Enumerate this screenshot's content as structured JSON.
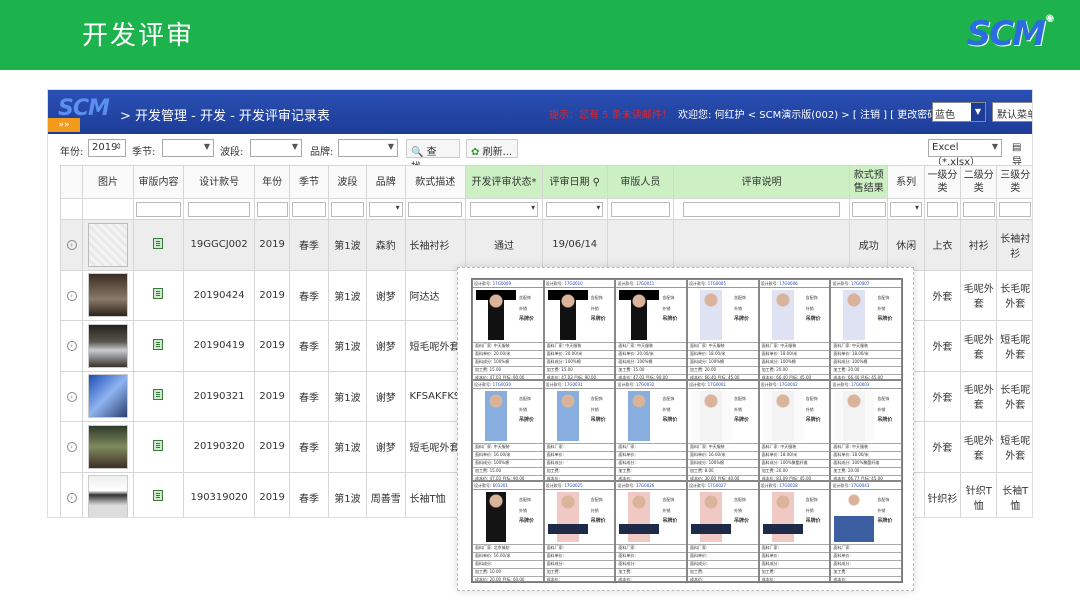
{
  "slide": {
    "title": "开发评审",
    "logo": "SCM",
    "logo_reg": "®"
  },
  "app": {
    "logo": "SCM",
    "tag": "»»",
    "breadcrumb": "> 开发管理 - 开发 - 开发评审记录表",
    "tip": "提示：您有 5 条未读邮件！",
    "welcome": "欢迎您: 何红护 < SCM演示版(002) > [ 注销 ] [ 更改密码 ]",
    "theme_select": "蓝色",
    "default_button": "默认菜单"
  },
  "filters": {
    "year_label": "年份:",
    "year_value": "2019",
    "season_label": "季节:",
    "wave_label": "波段:",
    "brand_label": "品牌:",
    "search_label": "查找...",
    "refresh_label": "刷新...",
    "export_value": "Excel（*.xlsx）",
    "export_label": "导"
  },
  "table": {
    "headers": [
      "图片",
      "审版内容",
      "设计款号",
      "年份",
      "季节",
      "波段",
      "品牌",
      "款式描述",
      "开发评审状态*",
      "评审日期",
      "审版人员",
      "评审说明",
      "款式预售结果",
      "系列",
      "一级分类",
      "二级分类",
      "三级分类"
    ],
    "rows": [
      {
        "no": "19GGCJ002",
        "year": "2019",
        "season": "春季",
        "wave": "第1波",
        "brand": "森豹",
        "desc": "长袖衬衫",
        "status": "通过",
        "date": "19/06/14",
        "result": "成功",
        "series": "休闲",
        "c1": "上衣",
        "c2": "衬衫",
        "c3": "长袖衬衫"
      },
      {
        "no": "20190424",
        "year": "2019",
        "season": "春季",
        "wave": "第1波",
        "brand": "谢梦",
        "desc": "阿达达",
        "status": "",
        "date": "",
        "result": "",
        "series": "",
        "c1": "外套",
        "c2": "毛呢外套",
        "c3": "长毛呢外套"
      },
      {
        "no": "20190419",
        "year": "2019",
        "season": "春季",
        "wave": "第1波",
        "brand": "谢梦",
        "desc": "短毛呢外套",
        "status": "",
        "date": "",
        "result": "",
        "series": "",
        "c1": "外套",
        "c2": "毛呢外套",
        "c3": "短毛呢外套"
      },
      {
        "no": "20190321",
        "year": "2019",
        "season": "春季",
        "wave": "第1波",
        "brand": "谢梦",
        "desc": "KFSAKFKSAF",
        "status": "",
        "date": "",
        "result": "",
        "series": "",
        "c1": "外套",
        "c2": "毛呢外套",
        "c3": "长毛呢外套"
      },
      {
        "no": "20190320",
        "year": "2019",
        "season": "春季",
        "wave": "第1波",
        "brand": "谢梦",
        "desc": "短毛呢外套",
        "status": "",
        "date": "",
        "result": "",
        "series": "",
        "c1": "外套",
        "c2": "毛呢外套",
        "c3": "短毛呢外套"
      },
      {
        "no": "190319020",
        "year": "2019",
        "season": "春季",
        "wave": "第1波",
        "brand": "周善雪",
        "desc": "长袖T恤",
        "status": "",
        "date": "",
        "result": "",
        "series": "",
        "c1": "针织衫",
        "c2": "针织T恤",
        "c3": "长袖T恤"
      }
    ]
  },
  "sheet": {
    "labels": {
      "design_no": "设计款号:",
      "fabric": "面料厂家:",
      "fabric_price": "面料单价:",
      "fabric_comp": "面料成分:",
      "process": "加工费:",
      "cost": "成本价:",
      "contains": "含配饰",
      "outer": "外销",
      "tag_price": "吊牌价"
    },
    "cards": [
      {
        "no": "17G0009",
        "fabric": "中天服装",
        "price": "20.00/米",
        "comp": "100%棉",
        "process": "15.00",
        "cost": "47.03  目标: 90.00",
        "pic": "black"
      },
      {
        "no": "17G0010",
        "fabric": "中天服装",
        "price": "20.00/米",
        "comp": "100%棉",
        "process": "15.00",
        "cost": "47.03  目标: 90.00",
        "pic": "black"
      },
      {
        "no": "17G0011",
        "fabric": "中天服装",
        "price": "20.00/米",
        "comp": "100%棉",
        "process": "15.00",
        "cost": "47.03  目标: 90.00",
        "pic": "black"
      },
      {
        "no": "17G0005",
        "fabric": "中天服装",
        "price": "18.00/米",
        "comp": "100%棉",
        "process": "20.00",
        "cost": "66.40  目标: 45.00",
        "pic": "white"
      },
      {
        "no": "17G0006",
        "fabric": "中天服装",
        "price": "18.00/米",
        "comp": "100%棉",
        "process": "20.00",
        "cost": "66.40  目标: 45.00",
        "pic": "white"
      },
      {
        "no": "17G0007",
        "fabric": "中天服装",
        "price": "18.00/米",
        "comp": "100%棉",
        "process": "20.00",
        "cost": "66.40  目标: 45.00",
        "pic": "white"
      },
      {
        "no": "17G0030",
        "fabric": "中天服装",
        "price": "16.00/米",
        "comp": "100%棉",
        "process": "15.00",
        "cost": "47.03  目标: 90.00",
        "pic": "blue"
      },
      {
        "no": "17G0031",
        "fabric": "",
        "price": "",
        "comp": "",
        "process": "",
        "cost": "",
        "pic": "blue"
      },
      {
        "no": "17G0032",
        "fabric": "",
        "price": "",
        "comp": "",
        "process": "",
        "cost": "",
        "pic": "blue"
      },
      {
        "no": "17G0001",
        "fabric": "中天服装",
        "price": "16.00/米",
        "comp": "100%棉",
        "process": "8.00",
        "cost": "30.60  目标: 40.00",
        "pic": "shirt"
      },
      {
        "no": "17G0002",
        "fabric": "中天服装",
        "price": "18.00/米",
        "comp": "100%聚酯纤维",
        "process": "20.00",
        "cost": "83.09  目标: 45.00",
        "pic": "shirt"
      },
      {
        "no": "17G0003",
        "fabric": "中天服装",
        "price": "18.00/米",
        "comp": "100%聚酯纤维",
        "process": "20.00",
        "cost": "66.77  目标: 45.00",
        "pic": "shirt"
      },
      {
        "no": "603301",
        "fabric": "北京城纺",
        "price": "16.00/米",
        "comp": "",
        "process": "10.00",
        "cost": "20.00  目标: 60.00",
        "pic": "dress"
      },
      {
        "no": "17G0025",
        "fabric": "",
        "price": "",
        "comp": "",
        "process": "",
        "cost": "",
        "pic": "pink"
      },
      {
        "no": "17G0026",
        "fabric": "",
        "price": "",
        "comp": "",
        "process": "",
        "cost": "",
        "pic": "pink"
      },
      {
        "no": "17G0027",
        "fabric": "",
        "price": "",
        "comp": "",
        "process": "",
        "cost": "",
        "pic": "pink"
      },
      {
        "no": "17G0028",
        "fabric": "",
        "price": "",
        "comp": "",
        "process": "",
        "cost": "",
        "pic": "pink"
      },
      {
        "no": "17G0043",
        "fabric": "",
        "price": "",
        "comp": "",
        "process": "",
        "cost": "",
        "pic": "jeans"
      }
    ]
  }
}
